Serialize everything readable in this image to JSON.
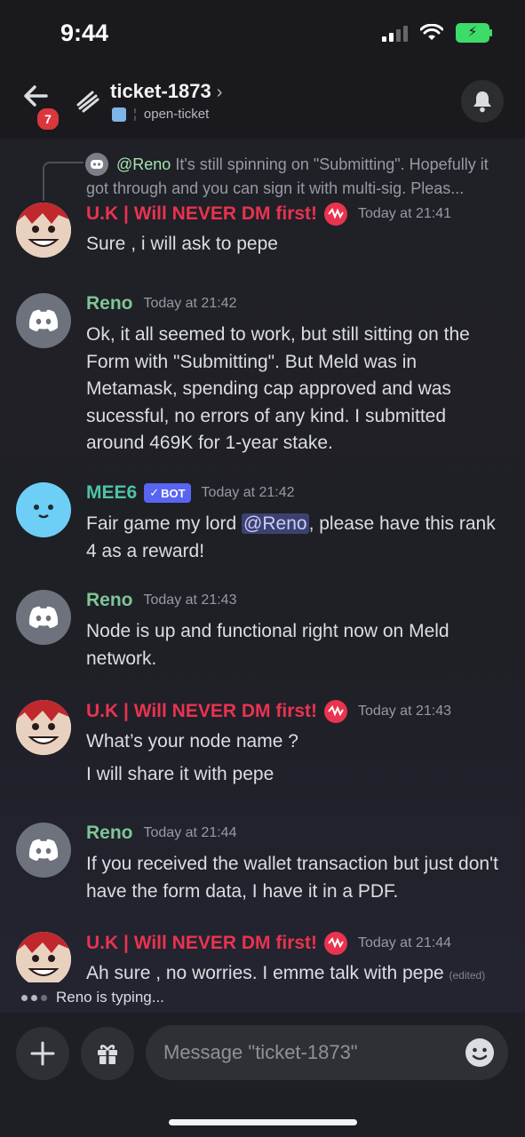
{
  "status": {
    "time": "9:44"
  },
  "header": {
    "back_badge": "7",
    "channel_name": "ticket-1873",
    "chevron": "›",
    "subtitle": "open-ticket"
  },
  "reply": {
    "author": "@Reno",
    "text": "It's still spinning on \"Submitting\".  Hopefully it got through and you can sign it with multi-sig.  Pleas..."
  },
  "messages": [
    {
      "author": "U.K | Will NEVER DM first!",
      "timestamp": "Today at 21:41",
      "lines": [
        "Sure , i will ask to pepe"
      ]
    },
    {
      "author": "Reno",
      "timestamp": "Today at 21:42",
      "lines": [
        "Ok, it all seemed to work, but still sitting on the Form with \"Submitting\".  But Meld was in Metamask, spending cap approved and was sucessful, no errors of any kind.  I submitted around 469K for 1-year stake."
      ]
    },
    {
      "author": "MEE6",
      "bot_tag": "BOT",
      "timestamp": "Today at 21:42",
      "text_before": "Fair game my lord ",
      "mention": "@Reno",
      "text_after": ", please have this rank 4 as a reward!"
    },
    {
      "author": "Reno",
      "timestamp": "Today at 21:43",
      "lines": [
        "Node is up and functional right now on Meld network."
      ]
    },
    {
      "author": "U.K | Will NEVER DM first!",
      "timestamp": "Today at 21:43",
      "lines": [
        "What’s your node name ?",
        "I will share it with pepe"
      ]
    },
    {
      "author": "Reno",
      "timestamp": "Today at 21:44",
      "lines": [
        "If you received the wallet transaction but just don't have the form data, I have it in a PDF."
      ]
    },
    {
      "author": "U.K | Will NEVER DM first!",
      "timestamp": "Today at 21:44",
      "lines": [
        "Ah sure , no worries. I emme talk with pepe"
      ],
      "edited": "(edited)"
    }
  ],
  "typing": {
    "text": "Reno is typing..."
  },
  "composer": {
    "placeholder": "Message \"ticket-1873\""
  },
  "colors": {
    "reno_name": "#7fc596",
    "uk_name": "#e9334f",
    "mee6_name": "#4ec3a6",
    "bot_tag": "#5865f2",
    "mention_bg": "#3c4270"
  }
}
